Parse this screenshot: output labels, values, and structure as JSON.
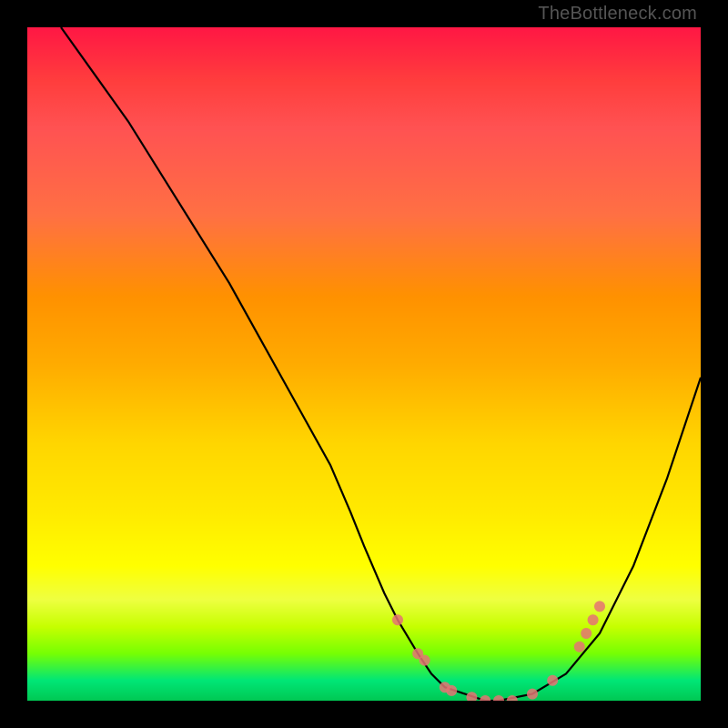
{
  "watermark": "TheBottleneck.com",
  "chart_data": {
    "type": "line",
    "title": "",
    "xlabel": "",
    "ylabel": "",
    "xlim": [
      0,
      100
    ],
    "ylim": [
      0,
      100
    ],
    "curve": {
      "name": "bottleneck-curve",
      "x": [
        5,
        10,
        15,
        20,
        25,
        30,
        35,
        40,
        45,
        48,
        50,
        53,
        55,
        58,
        60,
        62,
        65,
        68,
        70,
        75,
        80,
        85,
        90,
        95,
        100
      ],
      "y": [
        100,
        93,
        86,
        78,
        70,
        62,
        53,
        44,
        35,
        28,
        23,
        16,
        12,
        7,
        4,
        2,
        1,
        0,
        0,
        1,
        4,
        10,
        20,
        33,
        48
      ]
    },
    "markers": {
      "name": "highlighted-points",
      "color": "#e57373",
      "x": [
        55,
        58,
        59,
        62,
        63,
        66,
        68,
        70,
        72,
        75,
        78,
        82,
        83,
        84,
        85
      ],
      "y": [
        12,
        7,
        6,
        2,
        1.5,
        0.5,
        0,
        0,
        0,
        1,
        3,
        8,
        10,
        12,
        14
      ]
    },
    "gradient_stops": [
      {
        "pos": 0,
        "color": "#ff1744"
      },
      {
        "pos": 50,
        "color": "#ffd600"
      },
      {
        "pos": 80,
        "color": "#ffff00"
      },
      {
        "pos": 100,
        "color": "#00c853"
      }
    ]
  }
}
